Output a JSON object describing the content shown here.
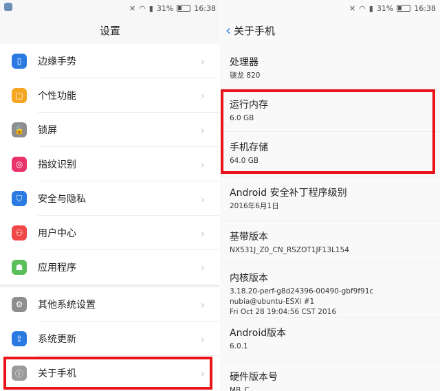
{
  "status": {
    "battery": "31%",
    "time": "16:38"
  },
  "left": {
    "title": "设置",
    "group1": [
      {
        "name": "gesture",
        "label": "边缘手势",
        "color": "#2a7ae2"
      },
      {
        "name": "personal",
        "label": "个性功能",
        "color": "#f5a623"
      },
      {
        "name": "lock",
        "label": "锁屏",
        "color": "#8e8e8e"
      },
      {
        "name": "fingerprint",
        "label": "指纹识别",
        "color": "#e8336b"
      },
      {
        "name": "privacy",
        "label": "安全与隐私",
        "color": "#2a7ae2"
      },
      {
        "name": "user",
        "label": "用户中心",
        "color": "#f04848"
      },
      {
        "name": "apps",
        "label": "应用程序",
        "color": "#5bbf5b"
      }
    ],
    "group2": [
      {
        "name": "other",
        "label": "其他系统设置",
        "color": "#8e8e8e"
      },
      {
        "name": "update",
        "label": "系统更新",
        "color": "#2a7ae2"
      },
      {
        "name": "about",
        "label": "关于手机",
        "color": "#9a9a9a"
      }
    ]
  },
  "right": {
    "title": "关于手机",
    "items": [
      {
        "name": "processor",
        "title": "处理器",
        "values": [
          "骁龙 820"
        ]
      },
      {
        "name": "ram",
        "title": "运行内存",
        "values": [
          "6.0 GB"
        ]
      },
      {
        "name": "storage",
        "title": "手机存储",
        "values": [
          "64.0 GB"
        ]
      },
      {
        "name": "security-patch",
        "title": "Android 安全补丁程序级别",
        "values": [
          "2016年6月1日"
        ]
      },
      {
        "name": "baseband",
        "title": "基带版本",
        "values": [
          "NX531J_Z0_CN_RSZOT1JF13L154"
        ]
      },
      {
        "name": "kernel",
        "title": "内核版本",
        "values": [
          "3.18.20-perf-g8d24396-00490-gbf9f91c",
          "nubia@ubuntu-ESXi #1",
          "Fri Oct 28 19:04:56 CST 2016"
        ]
      },
      {
        "name": "android-version",
        "title": "Android版本",
        "values": [
          "6.0.1"
        ]
      },
      {
        "name": "hardware",
        "title": "硬件版本号",
        "values": [
          "MB_C"
        ]
      }
    ]
  }
}
